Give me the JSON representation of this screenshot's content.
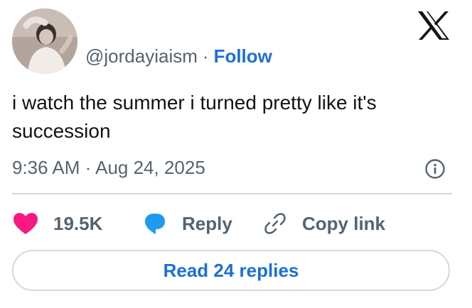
{
  "author": {
    "handle": "@jordayiaism",
    "separator": "·",
    "follow_label": "Follow"
  },
  "tweet": {
    "text": "i watch the summer i turned pretty like it's succession",
    "time": "9:36 AM",
    "date": "Aug 24, 2025",
    "meta_separator": "·"
  },
  "actions": {
    "like_count": "19.5K",
    "reply_label": "Reply",
    "copy_label": "Copy link"
  },
  "footer": {
    "read_replies_label": "Read 24 replies"
  },
  "icons": {
    "logo": "x-logo-icon",
    "info": "info-icon",
    "like": "heart-icon",
    "reply": "speech-bubble-icon",
    "copy": "link-icon"
  },
  "colors": {
    "accent_blue": "#1d6fd6",
    "heart_pink": "#f91880",
    "reply_blue": "#1d9bf0",
    "muted_text": "#536471",
    "divider": "#cfd9de"
  }
}
